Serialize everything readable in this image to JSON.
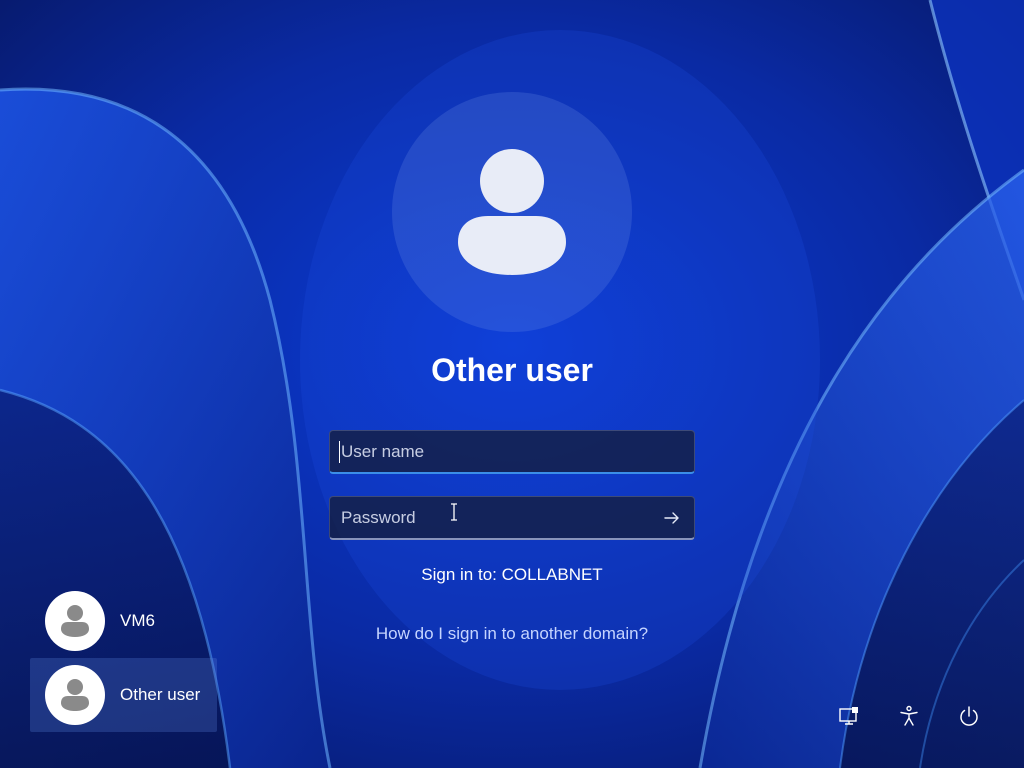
{
  "user": {
    "display_name": "Other user"
  },
  "form": {
    "username_placeholder": "User name",
    "password_placeholder": "Password",
    "submit_icon": "arrow-right-icon"
  },
  "domain": {
    "signin_text": "Sign in to: COLLABNET",
    "help_link": "How do I sign in to another domain?"
  },
  "user_list": [
    {
      "name": "VM6",
      "icon": "user-avatar-icon",
      "selected": false
    },
    {
      "name": "Other user",
      "icon": "user-avatar-icon",
      "selected": true
    }
  ],
  "tray": [
    {
      "name": "network",
      "icon": "network-icon"
    },
    {
      "name": "accessibility",
      "icon": "accessibility-icon"
    },
    {
      "name": "power",
      "icon": "power-icon"
    }
  ],
  "colors": {
    "background": "#0a2aa8",
    "focus_underline": "#3b8ee8",
    "link": "#c5d4ff"
  }
}
